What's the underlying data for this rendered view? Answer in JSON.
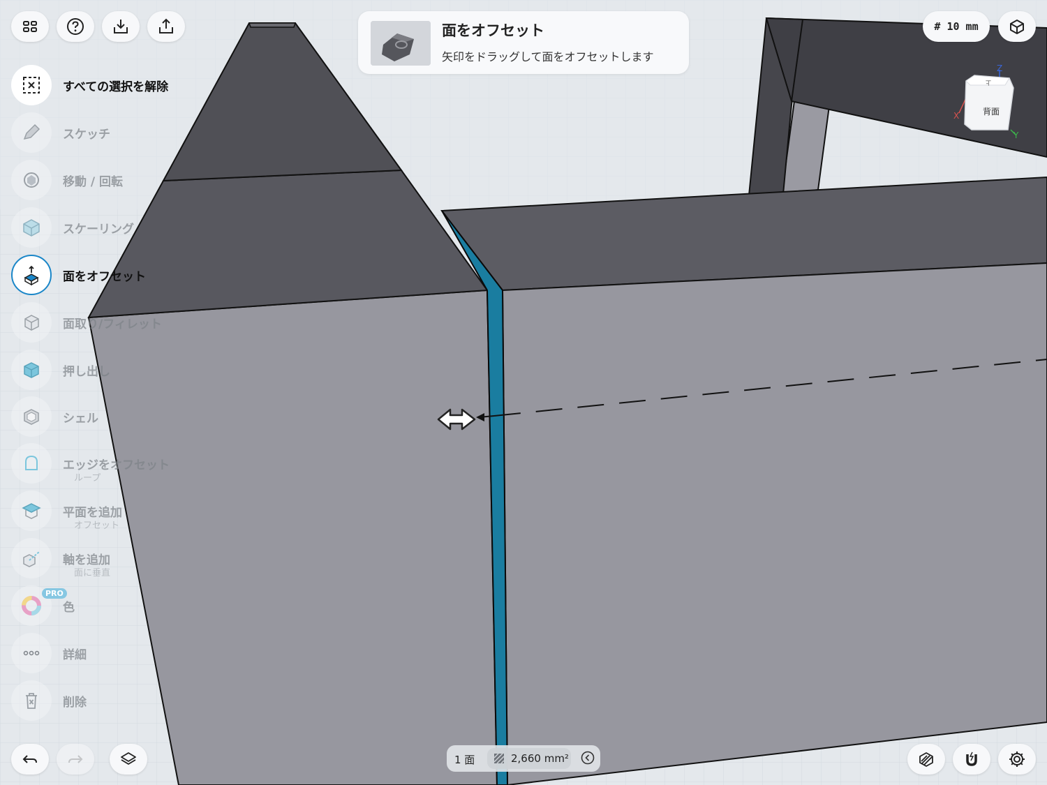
{
  "toolbar": {
    "grid_size": "# 10 mm"
  },
  "hint": {
    "title": "面をオフセット",
    "description": "矢印をドラッグして面をオフセットします"
  },
  "tools": [
    {
      "label": "すべての選択を解除",
      "icon": "deselect-all-icon",
      "state": "primary"
    },
    {
      "label": "スケッチ",
      "icon": "sketch-pen-icon",
      "state": "normal"
    },
    {
      "label": "移動 / 回転",
      "icon": "move-rotate-icon",
      "state": "normal"
    },
    {
      "label": "スケーリング",
      "icon": "scale-cube-icon",
      "state": "normal"
    },
    {
      "label": "面をオフセット",
      "icon": "offset-face-icon",
      "state": "active"
    },
    {
      "label": "面取り/フィレット",
      "icon": "chamfer-fillet-icon",
      "state": "normal"
    },
    {
      "label": "押し出し",
      "icon": "extrude-icon",
      "state": "normal"
    },
    {
      "label": "シェル",
      "icon": "shell-icon",
      "state": "normal"
    },
    {
      "label": "エッジをオフセット",
      "sublabel": "ループ",
      "icon": "offset-edge-icon",
      "state": "normal"
    },
    {
      "label": "平面を追加",
      "sublabel": "オフセット",
      "icon": "add-plane-icon",
      "state": "normal"
    },
    {
      "label": "軸を追加",
      "sublabel": "面に垂直",
      "icon": "add-axis-icon",
      "state": "normal"
    },
    {
      "label": "色",
      "badge": "PRO",
      "icon": "color-wheel-icon",
      "state": "normal"
    },
    {
      "label": "詳細",
      "icon": "more-dots-icon",
      "state": "normal"
    },
    {
      "label": "削除",
      "icon": "trash-icon",
      "state": "normal"
    }
  ],
  "view_cube": {
    "face_label": "背面",
    "top_label": "上",
    "axes": {
      "x": "X",
      "y": "Y",
      "z": "Z"
    }
  },
  "status": {
    "faces": "1 面",
    "area": "2,660 mm²"
  },
  "colors": {
    "selected_face": "#1a7da0",
    "body_side": "#97979f",
    "body_top": "#5c5c63",
    "accent": "#1a86c8"
  }
}
